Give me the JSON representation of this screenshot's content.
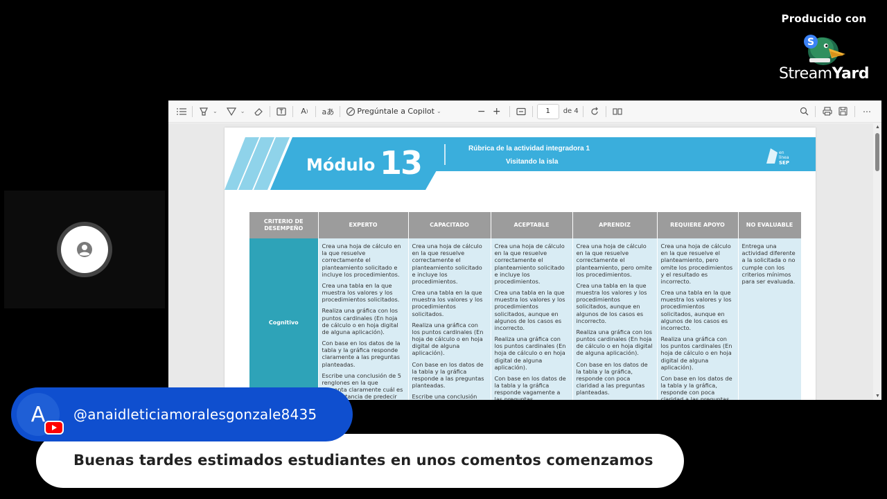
{
  "brand": {
    "produced_with": "Producido con",
    "name_light": "Stream",
    "name_bold": "Yard"
  },
  "viewer": {
    "toolbar": {
      "copilot_label": "Pregúntale a Copilot",
      "page_value": "1",
      "page_total": "de 4"
    },
    "banner": {
      "module_word": "Módulo",
      "module_number": "13",
      "subtitle_1": "Rúbrica de la actividad integradora 1",
      "subtitle_2": "Visitando la isla",
      "logo_text": "SEP"
    },
    "table": {
      "headers": [
        "CRITERIO DE DESEMPEÑO",
        "EXPERTO",
        "CAPACITADO",
        "ACEPTABLE",
        "APRENDIZ",
        "REQUIERE APOYO",
        "NO EVALUABLE"
      ],
      "criterion": "Cognitivo",
      "experto": [
        "Crea una hoja de cálculo en la que resuelve correctamente el planteamiento solicitado e incluye los procedimientos.",
        "Crea una tabla en la que muestra los valores y los procedimientos solicitados.",
        "Realiza una gráfica con los puntos cardinales (En hoja de cálculo o en hoja digital de alguna aplicación).",
        "Con base en los datos de la tabla y la gráfica responde claramente a las preguntas planteadas.",
        "Escribe una conclusión de 5 renglones en la que presenta claramente cuál es la importancia de predecir"
      ],
      "capacitado": [
        "Crea una hoja de cálculo en la que resuelve correctamente el planteamiento solicitado e incluye los procedimientos.",
        "Crea una tabla en la que muestra los valores y los procedimientos solicitados.",
        "Realiza una gráfica con los puntos cardinales (En hoja de cálculo o en hoja digital de alguna aplicación).",
        "Con base en los datos de la tabla y la gráfica responde a las preguntas planteadas.",
        "Escribe una conclusión"
      ],
      "aceptable": [
        "Crea una hoja de cálculo en la que resuelve correctamente el planteamiento solicitado e incluye los procedimientos.",
        "Crea una tabla en la que muestra los valores y los procedimientos solicitados, aunque en algunos de los casos es incorrecto.",
        "Realiza una gráfica con los puntos cardinales (En hoja de cálculo o en hoja digital de alguna aplicación).",
        "Con base en los datos de la tabla y la gráfica responde vagamente a las preguntas"
      ],
      "aprendiz": [
        "Crea una hoja de cálculo en la que resuelve correctamente el planteamiento, pero omite los procedimientos.",
        "Crea una tabla en la que muestra los valores y los procedimientos solicitados, aunque en algunos de los casos es incorrecto.",
        "Realiza una gráfica con los puntos cardinales (En hoja de cálculo o en hoja digital de alguna aplicación).",
        "Con base en los datos de la tabla y la gráfica, responde con poca claridad a las preguntas planteadas."
      ],
      "requiere_apoyo": [
        "Crea una hoja de cálculo en la que resuelve el planteamiento, pero omite los procedimientos y el resultado es incorrecto.",
        "Crea una tabla en la que muestra los valores y los procedimientos solicitados, aunque en algunos de los casos es incorrecto.",
        "Realiza una gráfica con los puntos cardinales (En hoja de cálculo o en hoja digital de alguna aplicación).",
        "Con base en los datos de la tabla y la gráfica, responde con poca claridad a las preguntas"
      ],
      "no_evaluable": [
        "Entrega una actividad diferente a la solicitada o no cumple con los criterios mínimos para ser evaluada."
      ]
    }
  },
  "chat": {
    "avatar_letter": "A",
    "handle": "@anaidleticiamoralesgonzale8435",
    "message": "Buenas tardes estimados estudiantes en unos comentos comenzamos"
  },
  "colors": {
    "banner_blue": "#3aaedc",
    "banner_light": "#8fd3ea",
    "criterion_teal": "#2ea3b8",
    "header_gray": "#9c9c9c",
    "cell_bg": "#d9ecf4",
    "chat_blue": "#0f4fcf",
    "youtube_red": "#ff0000"
  }
}
